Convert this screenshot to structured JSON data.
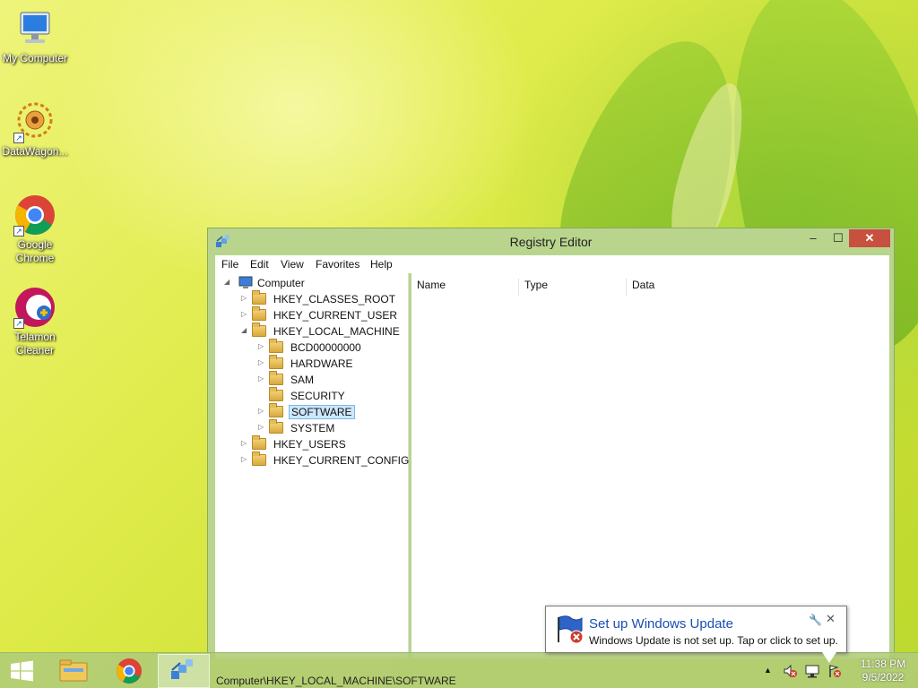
{
  "desktop": {
    "icons": [
      {
        "label": "My Computer",
        "icon": "computer-icon"
      },
      {
        "label": "DataWagon...",
        "icon": "datawagon-icon"
      },
      {
        "label": "Google Chrome",
        "icon": "chrome-icon"
      },
      {
        "label": "Telamon Cleaner",
        "icon": "telamon-cleaner-icon"
      }
    ]
  },
  "window": {
    "title": "Registry Editor",
    "icon": "regedit-icon",
    "controls": {
      "minimize": "–",
      "maximize": "☐",
      "close": "✕"
    },
    "menu": [
      "File",
      "Edit",
      "View",
      "Favorites",
      "Help"
    ],
    "tree": [
      {
        "label": "Computer",
        "expander": "◢"
      },
      {
        "label": "HKEY_CLASSES_ROOT",
        "expander": "▷"
      },
      {
        "label": "HKEY_CURRENT_USER",
        "expander": "▷"
      },
      {
        "label": "HKEY_LOCAL_MACHINE",
        "expander": "◢"
      },
      {
        "label": "BCD00000000",
        "expander": "▷"
      },
      {
        "label": "HARDWARE",
        "expander": "▷"
      },
      {
        "label": "SAM",
        "expander": "▷"
      },
      {
        "label": "SECURITY",
        "expander": ""
      },
      {
        "label": "SOFTWARE",
        "expander": "▷",
        "selected": true
      },
      {
        "label": "SYSTEM",
        "expander": "▷"
      },
      {
        "label": "HKEY_USERS",
        "expander": "▷"
      },
      {
        "label": "HKEY_CURRENT_CONFIG",
        "expander": "▷"
      }
    ],
    "columns": [
      "Name",
      "Type",
      "Data"
    ],
    "status_path": "Computer\\HKEY_LOCAL_MACHINE\\SOFTWARE"
  },
  "taskbar": {
    "start_icon": "windows-start-icon",
    "pinned": [
      "file-explorer-icon",
      "chrome-icon",
      "regedit-icon"
    ],
    "tray": {
      "show_hidden": "▲",
      "volume_icon": "volume-muted-icon",
      "network_icon": "network-icon",
      "action_center_icon": "action-center-error-icon"
    },
    "clock": {
      "time": "11:38 PM",
      "date": "9/5/2022"
    }
  },
  "notification": {
    "title": "Set up Windows Update",
    "message": "Windows Update is not set up. Tap or click to set up.",
    "icon": "windows-update-flag-icon",
    "wrench": "🔧",
    "close": "✕"
  }
}
